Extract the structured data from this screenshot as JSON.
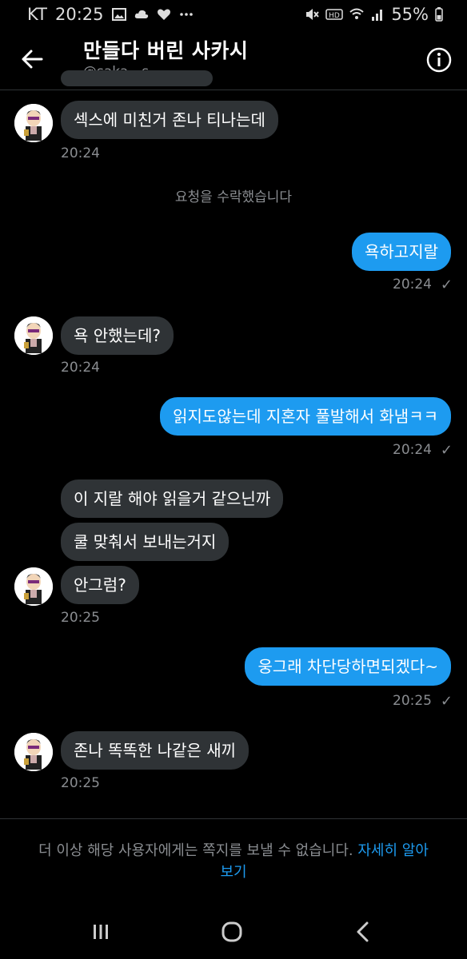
{
  "status_bar": {
    "carrier": "KT",
    "time": "20:25",
    "battery": "55%",
    "icons": [
      "gallery-icon",
      "cloud-icon",
      "heart-icon",
      "more-dots-icon",
      "mute-icon",
      "hd-icon",
      "wifi-icon",
      "signal-icon",
      "battery-icon"
    ]
  },
  "header": {
    "title": "만들다 버린 사카시",
    "handle": "@saka__s"
  },
  "messages": [
    {
      "dir": "in",
      "text": "섹스에 미친거 존나 티나는데"
    },
    {
      "dir": "in",
      "time": "20:24"
    },
    {
      "system": "요청을 수락했습니다"
    },
    {
      "dir": "out",
      "text": "욕하고지랄",
      "time": "20:24"
    },
    {
      "dir": "in",
      "text": "욕 안했는데?",
      "time": "20:24"
    },
    {
      "dir": "out",
      "text": "읽지도않는데 지혼자 풀발해서 화냄ㅋㅋ",
      "time": "20:24"
    },
    {
      "dir": "in",
      "text": "이 지랄 해야 읽을거 같으닌까"
    },
    {
      "dir": "in",
      "text": "쿨 맞춰서 보내는거지"
    },
    {
      "dir": "in",
      "text": "안그럼?",
      "time": "20:25"
    },
    {
      "dir": "out",
      "text": "웅그래 차단당하면되겠다~",
      "time": "20:25"
    },
    {
      "dir": "in",
      "text": "존나 똑똑한 나같은 새끼",
      "time": "20:25"
    }
  ],
  "footer": {
    "notice": "더 이상 해당 사용자에게는 쪽지를 보낼 수 없습니다.",
    "link": "자세히 알아보기"
  },
  "colors": {
    "background": "#000000",
    "incoming_bubble": "#2f3336",
    "outgoing_bubble": "#1d9bf0",
    "secondary_text": "#8a8d91"
  }
}
